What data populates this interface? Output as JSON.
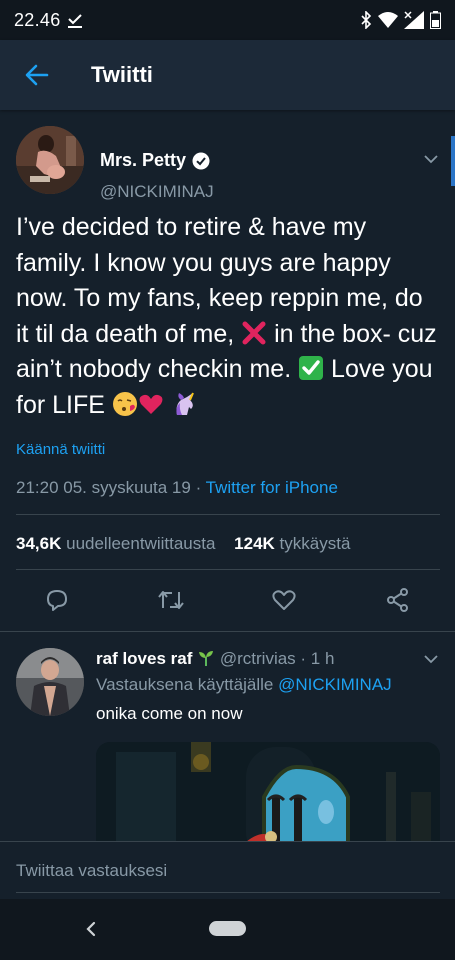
{
  "status_bar": {
    "time": "22.46"
  },
  "header": {
    "title": "Twiitti"
  },
  "tweet": {
    "author_name": "Mrs. Petty",
    "author_handle": "@NICKIMINAJ",
    "text_part1": "I’ve decided to retire & have my family. I know you guys are happy now. To my fans, keep reppin me, do it til da death of me, ",
    "text_part2": " in the box- cuz ain’t nobody checkin me. ",
    "text_part3": " Love you for LIFE ",
    "translate_label": "Käännä twiitti",
    "timestamp": "21:20 05. syyskuuta 19 · ",
    "source": "Twitter for iPhone",
    "retweet_count": "34,6K",
    "retweet_label": "uudelleentwiittausta",
    "like_count": "124K",
    "like_label": "tykkäystä"
  },
  "reply": {
    "name": "raf loves raf",
    "handle": "@rctrivias",
    "time": "· 1 h",
    "context_prefix": "Vastauksena käyttäjälle ",
    "context_mention": "@NICKIMINAJ",
    "text": "onika come on now"
  },
  "compose": {
    "placeholder": "Twiittaa vastauksesi"
  },
  "colors": {
    "background": "#15202b",
    "header": "#1c2938",
    "accent": "#1da1f2",
    "secondary_text": "#8899a6"
  }
}
